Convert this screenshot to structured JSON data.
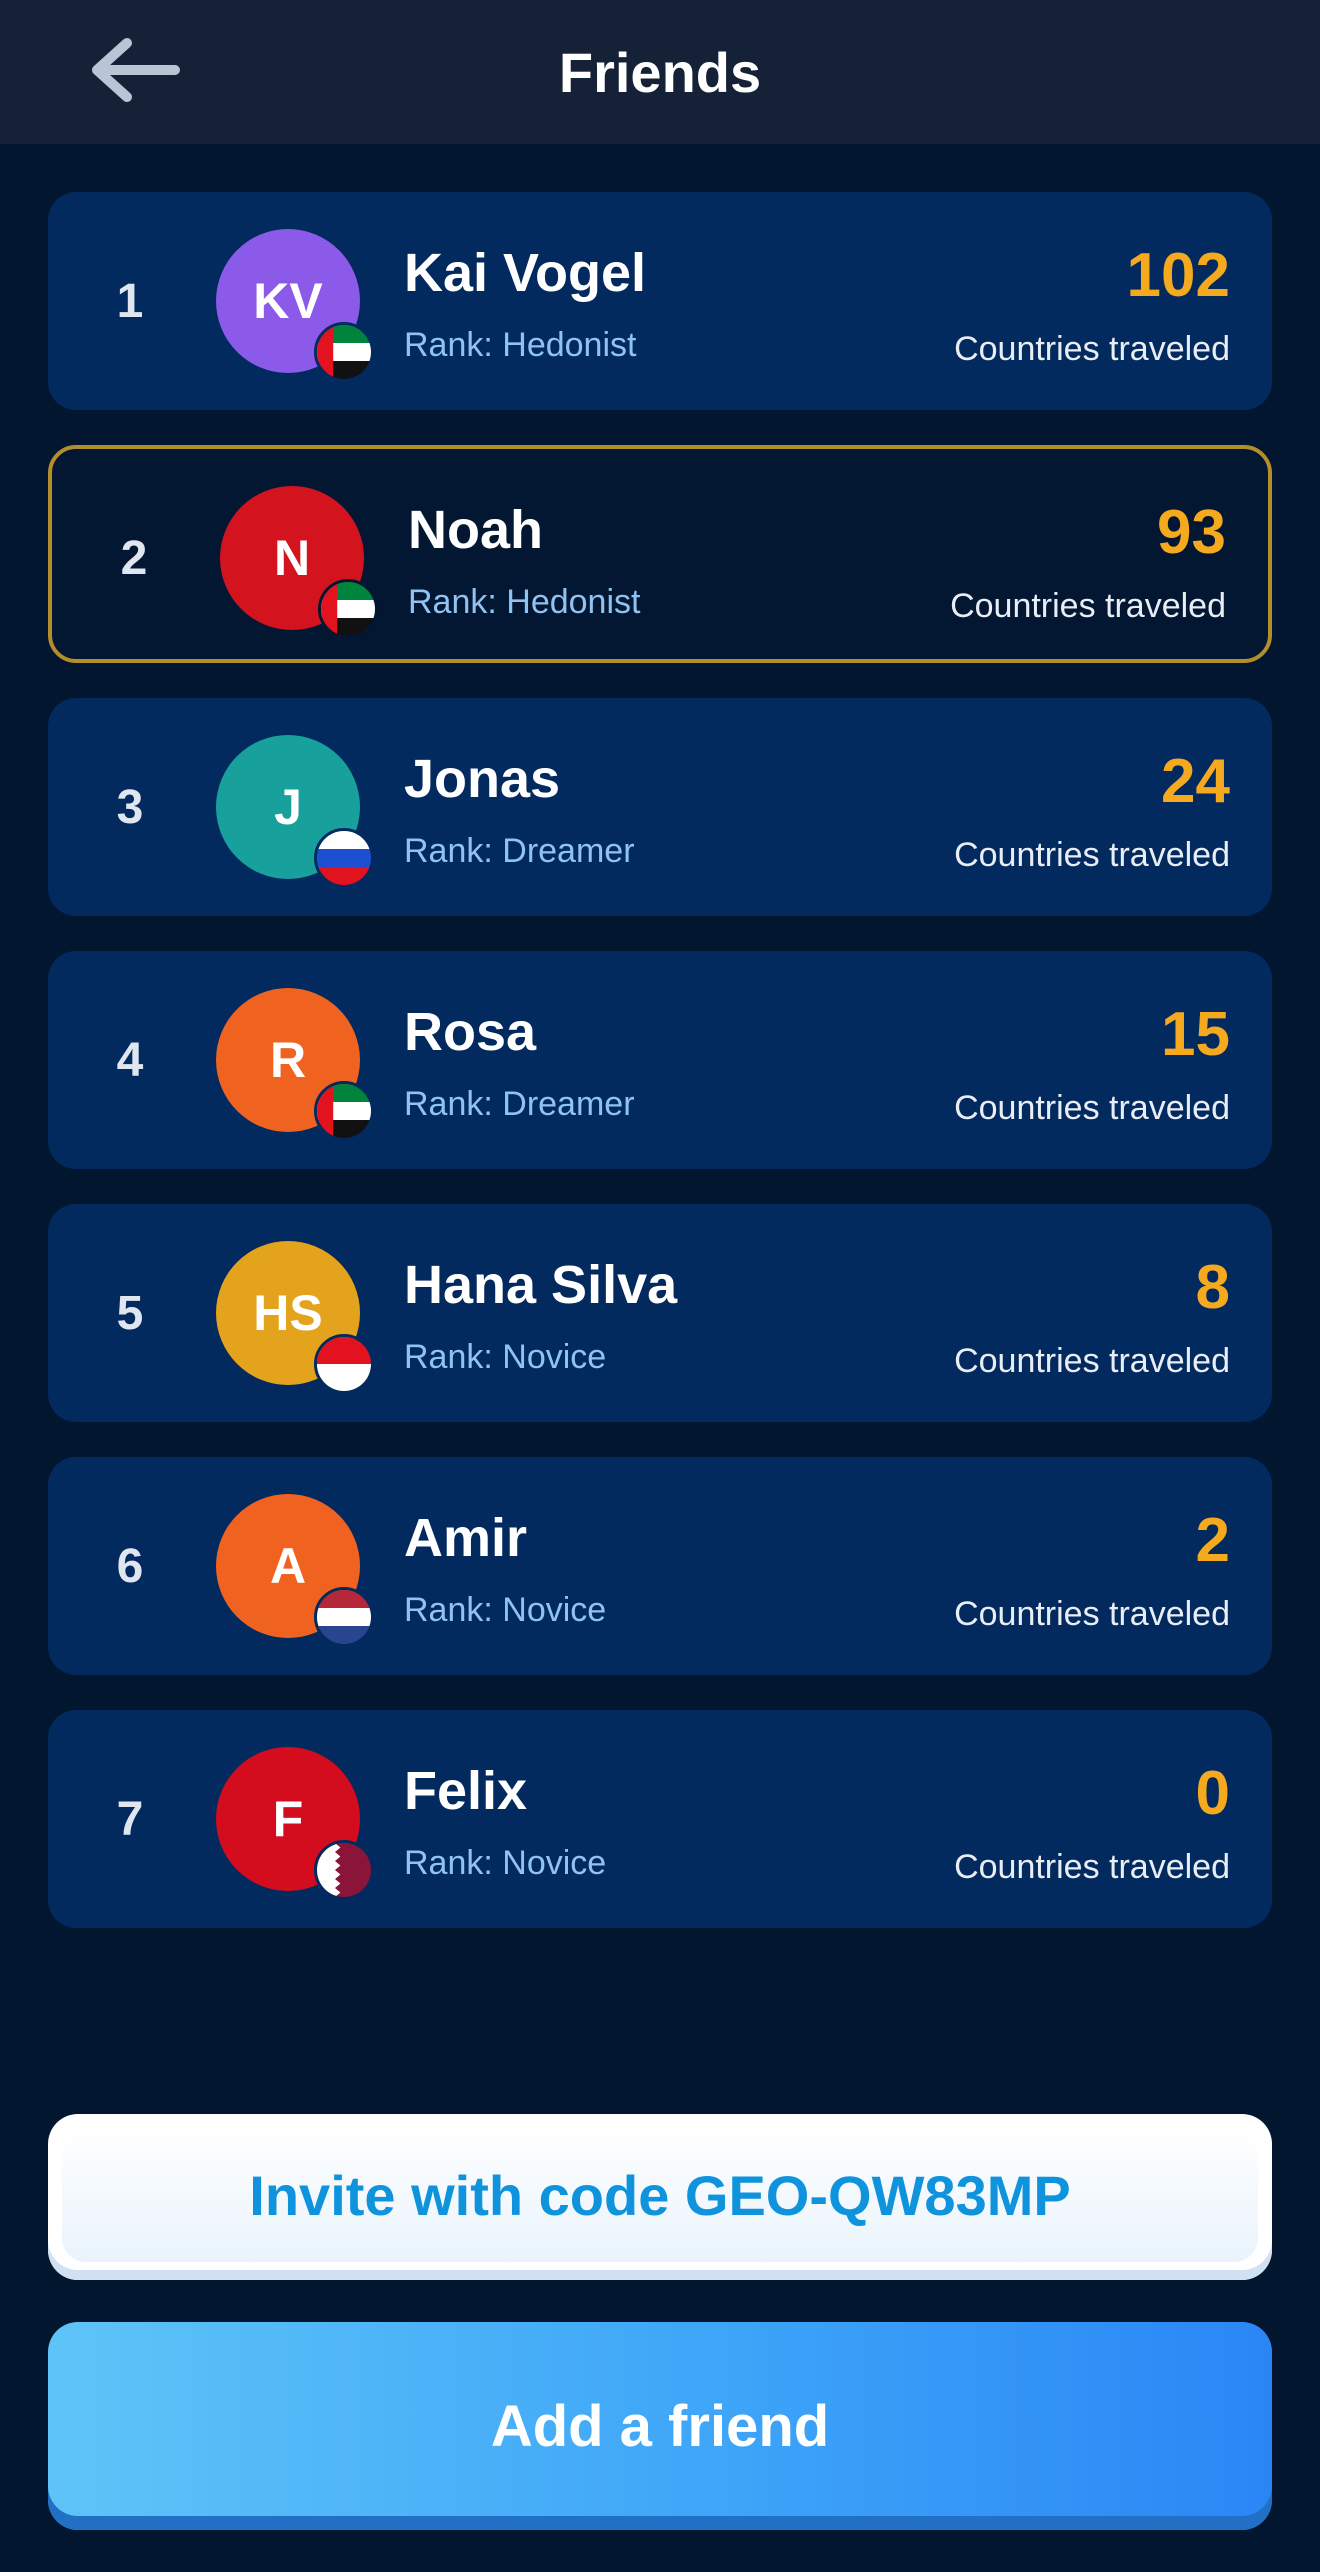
{
  "header": {
    "title": "Friends",
    "back_icon": "arrow-left-icon"
  },
  "friends": [
    {
      "rank": "1",
      "initials": "KV",
      "name": "Kai Vogel",
      "rank_label": "Rank: Hedonist",
      "count": "102",
      "count_label": "Countries traveled",
      "avatar_color": "#8b5ae8",
      "flag": "uae",
      "highlight": false
    },
    {
      "rank": "2",
      "initials": "N",
      "name": "Noah",
      "rank_label": "Rank: Hedonist",
      "count": "93",
      "count_label": "Countries traveled",
      "avatar_color": "#d3141f",
      "flag": "uae",
      "highlight": true
    },
    {
      "rank": "3",
      "initials": "J",
      "name": "Jonas",
      "rank_label": "Rank: Dreamer",
      "count": "24",
      "count_label": "Countries traveled",
      "avatar_color": "#18a09c",
      "flag": "russia",
      "highlight": false
    },
    {
      "rank": "4",
      "initials": "R",
      "name": "Rosa",
      "rank_label": "Rank: Dreamer",
      "count": "15",
      "count_label": "Countries traveled",
      "avatar_color": "#f0621f",
      "flag": "uae",
      "highlight": false
    },
    {
      "rank": "5",
      "initials": "HS",
      "name": "Hana Silva",
      "rank_label": "Rank: Novice",
      "count": "8",
      "count_label": "Countries traveled",
      "avatar_color": "#e3a31c",
      "flag": "indonesia",
      "highlight": false
    },
    {
      "rank": "6",
      "initials": "A",
      "name": "Amir",
      "rank_label": "Rank: Novice",
      "count": "2",
      "count_label": "Countries traveled",
      "avatar_color": "#f0621f",
      "flag": "netherlands",
      "highlight": false
    },
    {
      "rank": "7",
      "initials": "F",
      "name": "Felix",
      "rank_label": "Rank: Novice",
      "count": "0",
      "count_label": "Countries traveled",
      "avatar_color": "#d30c1e",
      "flag": "qatar",
      "highlight": false
    }
  ],
  "invite": {
    "label": "Invite with code GEO-QW83MP"
  },
  "add_friend": {
    "label": "Add a friend"
  },
  "colors": {
    "background": "#03162f",
    "card": "#032a5e",
    "highlight_border": "#b38e2b",
    "count": "#f5a91f",
    "rank_text": "#8fc3f2"
  }
}
